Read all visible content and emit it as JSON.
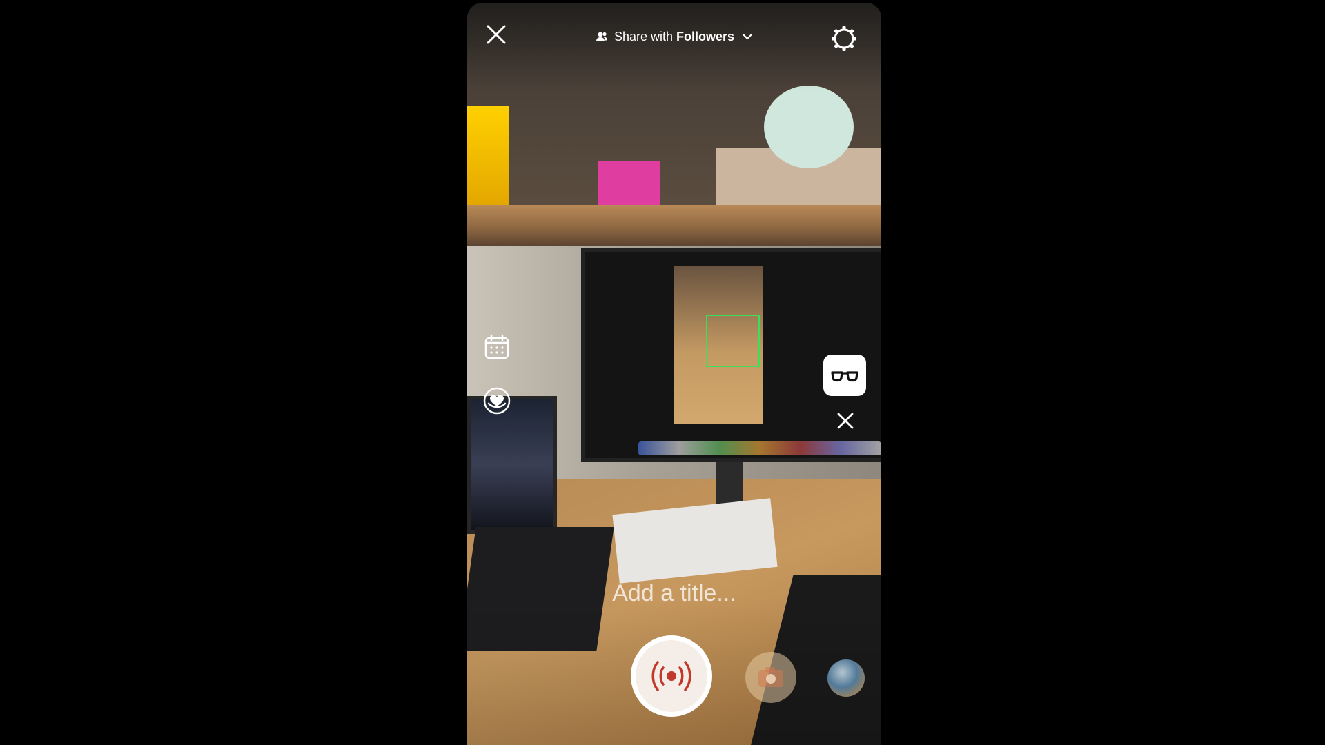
{
  "header": {
    "share_prefix": "Share with",
    "share_audience": "Followers"
  },
  "title_field": {
    "placeholder": "Add a title..."
  },
  "icons": {
    "close": "close-icon",
    "share_people": "people-icon",
    "dropdown": "chevron-down-icon",
    "settings": "settings-gear-icon",
    "schedule": "calendar-icon",
    "fundraiser": "heart-badge-icon",
    "effects": "glasses-icon",
    "remove_effect": "close-icon",
    "go_live": "broadcast-icon",
    "effect_thumb": "camera-effect-icon",
    "gallery": "gallery-thumbnail"
  },
  "colors": {
    "live_button_accent": "#c0392b",
    "ui_white": "#ffffff"
  }
}
